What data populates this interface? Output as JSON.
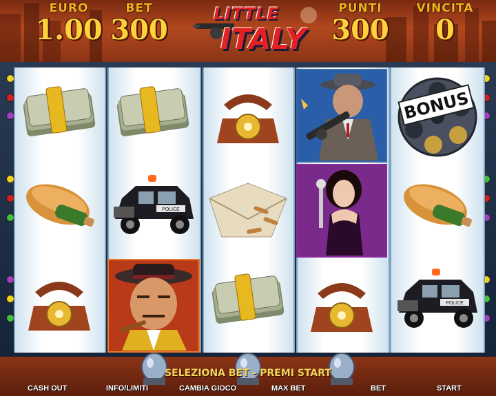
{
  "header": {
    "euro_label": "EURO",
    "euro_value": "1.00",
    "bet_label": "BET",
    "bet_value": "300",
    "punti_label": "PUNTI",
    "punti_value": "300",
    "vincita_label": "VINCITA",
    "vincita_value": "0",
    "logo_top": "LITTLE",
    "logo_main": "ITALY"
  },
  "reels": [
    [
      "cash-bundle",
      "bread-bottle",
      "rotary-phone"
    ],
    [
      "cash-bundle",
      "police-car",
      "boss-cigar"
    ],
    [
      "rotary-phone",
      "envelope-bullets",
      "cash-bundle"
    ],
    [
      "gangster-tommy-gun",
      "lady-singer",
      "rotary-phone"
    ],
    [
      "bonus-revolver",
      "bread-bottle",
      "police-car"
    ]
  ],
  "bonus_text": "BONUS",
  "police_text": "POLICE",
  "message": "SELEZIONA BET - PREMI START",
  "buttons": {
    "cash_out": "CASH OUT",
    "info": "INFO/LIMITI",
    "cambia": "CAMBIA GIOCO",
    "max_bet": "MAX BET",
    "bet": "BET",
    "start": "START"
  },
  "colors": {
    "accent_gold": "#ffd23a",
    "logo_red": "#e22222",
    "bonus_frame": "#3a6aa8",
    "lady_frame": "#8a2a9a"
  }
}
